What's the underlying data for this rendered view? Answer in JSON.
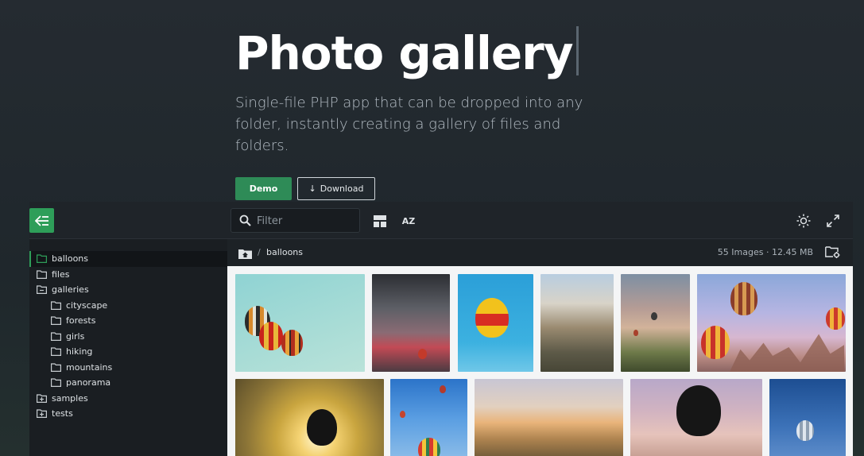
{
  "hero": {
    "title": "Photo gallery",
    "subtitle": "Single-file PHP app that can be dropped into any folder, instantly creating a gallery of files and folders.",
    "demo_label": "Demo",
    "download_label": "Download",
    "download_icon": "↓"
  },
  "toolbar": {
    "filter_placeholder": "Filter",
    "sort_label": "AZ"
  },
  "sidebar": {
    "items": [
      {
        "label": "balloons",
        "icon": "folder-icon"
      },
      {
        "label": "files",
        "icon": "folder-icon"
      },
      {
        "label": "galleries",
        "icon": "folder-open-icon"
      },
      {
        "label": "cityscape",
        "icon": "folder-icon"
      },
      {
        "label": "forests",
        "icon": "folder-icon"
      },
      {
        "label": "girls",
        "icon": "folder-icon"
      },
      {
        "label": "hiking",
        "icon": "folder-icon"
      },
      {
        "label": "mountains",
        "icon": "folder-icon"
      },
      {
        "label": "panorama",
        "icon": "folder-icon"
      },
      {
        "label": "samples",
        "icon": "folder-plus-icon"
      },
      {
        "label": "tests",
        "icon": "folder-plus-icon"
      }
    ]
  },
  "breadcrumb": {
    "separator": "/",
    "current": "balloons"
  },
  "stats": "55 Images · 12.45 MB",
  "colors": {
    "accent": "#2e9e59",
    "background": "#1f262b"
  }
}
